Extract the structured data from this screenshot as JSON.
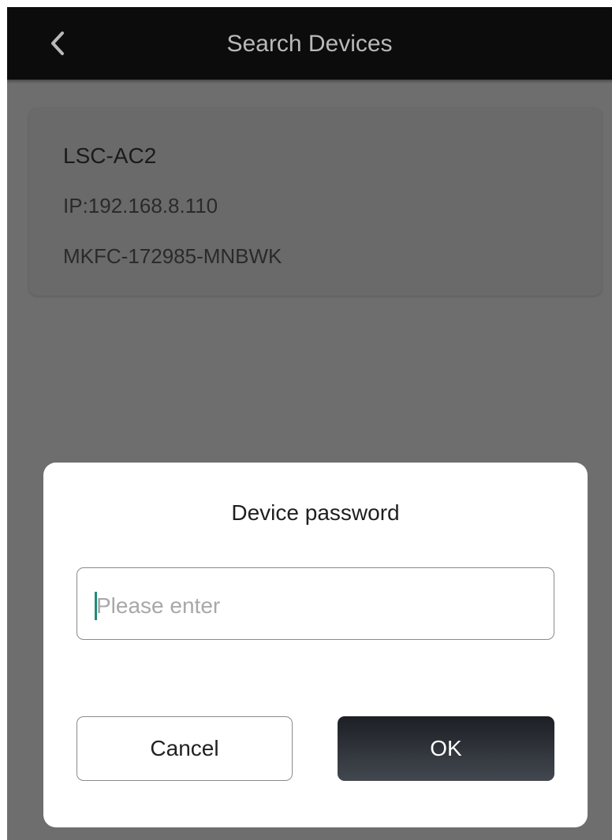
{
  "header": {
    "title": "Search Devices",
    "back_icon": "chevron-left-icon"
  },
  "device": {
    "name": "LSC-AC2",
    "ip": "IP:192.168.8.110",
    "id": "MKFC-172985-MNBWK"
  },
  "dialog": {
    "title": "Device password",
    "password_placeholder": "Please enter",
    "password_value": "",
    "cancel_label": "Cancel",
    "ok_label": "OK"
  },
  "colors": {
    "header_bg": "#0c0c0c",
    "overlay_bg": "#6e6e6e",
    "ok_button_bg": "#2a2e34",
    "caret": "#1f8c7a"
  }
}
